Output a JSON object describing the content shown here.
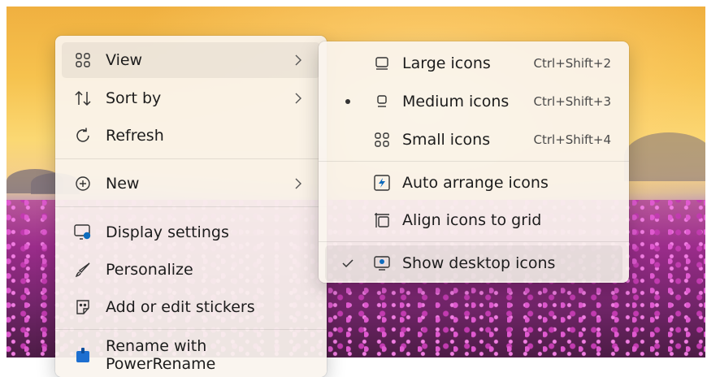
{
  "main_menu": {
    "items": [
      {
        "label": "View",
        "icon": "view-grid-icon",
        "has_submenu": true
      },
      {
        "label": "Sort by",
        "icon": "sort-icon",
        "has_submenu": true
      },
      {
        "label": "Refresh",
        "icon": "refresh-icon",
        "has_submenu": false
      },
      {
        "label": "New",
        "icon": "new-plus-icon",
        "has_submenu": true
      },
      {
        "label": "Display settings",
        "icon": "display-settings-icon",
        "has_submenu": false
      },
      {
        "label": "Personalize",
        "icon": "brush-icon",
        "has_submenu": false
      },
      {
        "label": "Add or edit stickers",
        "icon": "sticker-icon",
        "has_submenu": false
      },
      {
        "label": "Rename with PowerRename",
        "icon": "powerrename-icon",
        "has_submenu": false
      }
    ]
  },
  "view_submenu": {
    "items": [
      {
        "label": "Large icons",
        "shortcut": "Ctrl+Shift+2",
        "icon": "large-icons-icon",
        "selected": false
      },
      {
        "label": "Medium icons",
        "shortcut": "Ctrl+Shift+3",
        "icon": "medium-icons-icon",
        "selected": true
      },
      {
        "label": "Small icons",
        "shortcut": "Ctrl+Shift+4",
        "icon": "small-icons-icon",
        "selected": false
      },
      {
        "label": "Auto arrange icons",
        "icon": "auto-arrange-icon",
        "checked": false
      },
      {
        "label": "Align icons to grid",
        "icon": "align-grid-icon",
        "checked": false
      },
      {
        "label": "Show desktop icons",
        "icon": "show-desktop-icon",
        "checked": true
      }
    ]
  },
  "colors": {
    "accent": "#0f6cbd",
    "text": "#1c1c1c"
  }
}
